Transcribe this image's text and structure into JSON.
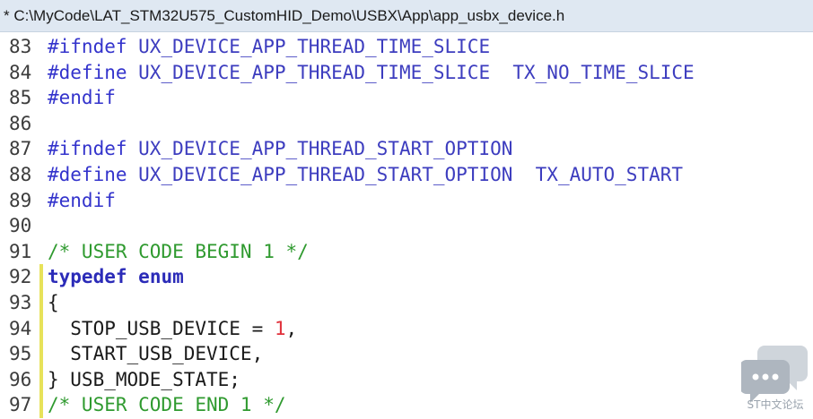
{
  "window": {
    "title": "* C:\\MyCode\\LAT_STM32U575_CustomHID_Demo\\USBX\\App\\app_usbx_device.h"
  },
  "editor": {
    "lines": [
      {
        "num": "83",
        "tokens": [
          {
            "t": "#ifndef",
            "c": "kw"
          },
          {
            "t": " UX_DEVICE_APP_THREAD_TIME_SLICE",
            "c": "macro"
          }
        ]
      },
      {
        "num": "84",
        "tokens": [
          {
            "t": "#define",
            "c": "kw"
          },
          {
            "t": " UX_DEVICE_APP_THREAD_TIME_SLICE  TX_NO_TIME_SLICE",
            "c": "macro"
          }
        ]
      },
      {
        "num": "85",
        "tokens": [
          {
            "t": "#endif",
            "c": "kw"
          }
        ]
      },
      {
        "num": "86",
        "tokens": []
      },
      {
        "num": "87",
        "tokens": [
          {
            "t": "#ifndef",
            "c": "kw"
          },
          {
            "t": " UX_DEVICE_APP_THREAD_START_OPTION",
            "c": "macro"
          }
        ]
      },
      {
        "num": "88",
        "tokens": [
          {
            "t": "#define",
            "c": "kw"
          },
          {
            "t": " UX_DEVICE_APP_THREAD_START_OPTION  TX_AUTO_START",
            "c": "macro"
          }
        ]
      },
      {
        "num": "89",
        "tokens": [
          {
            "t": "#endif",
            "c": "kw"
          }
        ]
      },
      {
        "num": "90",
        "tokens": []
      },
      {
        "num": "91",
        "tokens": [
          {
            "t": "/* USER CODE BEGIN 1 */",
            "c": "cmt"
          }
        ]
      },
      {
        "num": "92",
        "mark": true,
        "tokens": [
          {
            "t": "typedef",
            "c": "kwb"
          },
          {
            "t": " ",
            "c": "txt"
          },
          {
            "t": "enum",
            "c": "kwb"
          }
        ]
      },
      {
        "num": "93",
        "mark": true,
        "tokens": [
          {
            "t": "{",
            "c": "brace"
          }
        ]
      },
      {
        "num": "94",
        "mark": true,
        "tokens": [
          {
            "t": "  STOP_USB_DEVICE = ",
            "c": "txt"
          },
          {
            "t": "1",
            "c": "num"
          },
          {
            "t": ",",
            "c": "txt"
          }
        ]
      },
      {
        "num": "95",
        "mark": true,
        "tokens": [
          {
            "t": "  START_USB_DEVICE,",
            "c": "txt"
          }
        ]
      },
      {
        "num": "96",
        "mark": true,
        "tokens": [
          {
            "t": "} USB_MODE_STATE;",
            "c": "txt"
          }
        ]
      },
      {
        "num": "97",
        "mark": true,
        "tokens": [
          {
            "t": "/* USER CODE END 1 */",
            "c": "cmt"
          }
        ]
      }
    ]
  },
  "watermark": {
    "text": "ST中文论坛",
    "icon": "chat-bubbles-icon"
  }
}
